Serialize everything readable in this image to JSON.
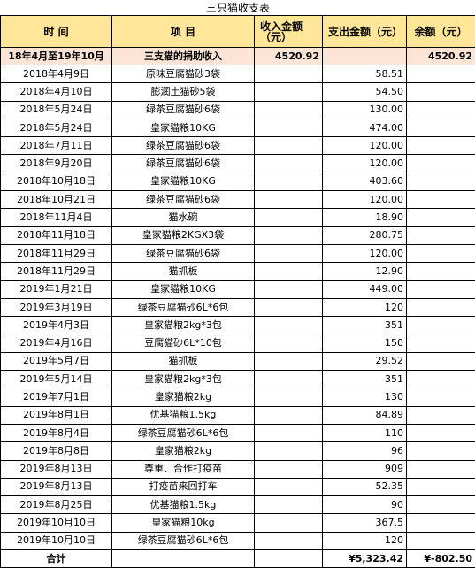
{
  "title": "三只猫收支表",
  "headers": {
    "date": "时    间",
    "item": "项    目",
    "income": "收入金额（元）",
    "expense": "支出金额（元）",
    "balance": "余额（元）"
  },
  "income_row": {
    "date": "18年4月至19年10月",
    "item": "三支猫的捐助收入",
    "income": "4520.92",
    "expense": "",
    "balance": "4520.92"
  },
  "rows": [
    {
      "date": "2018年4月9日",
      "item": "原味豆腐猫砂3袋",
      "expense": "58.51"
    },
    {
      "date": "2018年4月10日",
      "item": "膨润土猫砂5袋",
      "expense": "54.50"
    },
    {
      "date": "2018年5月24日",
      "item": "绿茶豆腐猫砂6袋",
      "expense": "130.00"
    },
    {
      "date": "2018年5月24日",
      "item": "皇家猫粮10KG",
      "expense": "474.00"
    },
    {
      "date": "2018年7月11日",
      "item": "绿茶豆腐猫砂6袋",
      "expense": "120.00"
    },
    {
      "date": "2018年9月20日",
      "item": "绿茶豆腐猫砂6袋",
      "expense": "120.00"
    },
    {
      "date": "2018年10月18日",
      "item": "皇家猫粮10KG",
      "expense": "403.60"
    },
    {
      "date": "2018年10月21日",
      "item": "绿茶豆腐猫砂6袋",
      "expense": "120.00"
    },
    {
      "date": "2018年11月4日",
      "item": "猫水碗",
      "expense": "18.90"
    },
    {
      "date": "2018年11月18日",
      "item": "皇家猫粮2KGX3袋",
      "expense": "280.75"
    },
    {
      "date": "2018年11月29日",
      "item": "绿茶豆腐猫砂6袋",
      "expense": "120.00"
    },
    {
      "date": "2018年11月29日",
      "item": "猫抓板",
      "expense": "12.90"
    },
    {
      "date": "2019年1月21日",
      "item": "皇家猫粮10KG",
      "expense": "449.00"
    },
    {
      "date": "2019年3月19日",
      "item": "绿茶豆腐猫砂6L*6包",
      "expense": "120"
    },
    {
      "date": "2019年4月3日",
      "item": "皇家猫粮2kg*3包",
      "expense": "351"
    },
    {
      "date": "2019年4月16日",
      "item": "豆腐猫砂6L*10包",
      "expense": "150"
    },
    {
      "date": "2019年5月7日",
      "item": "猫抓板",
      "expense": "29.52"
    },
    {
      "date": "2019年5月14日",
      "item": "皇家猫粮2kg*3包",
      "expense": "351"
    },
    {
      "date": "2019年7月1日",
      "item": "皇家猫粮2kg",
      "expense": "130"
    },
    {
      "date": "2019年8月1日",
      "item": "优基猫粮1.5kg",
      "expense": "84.89"
    },
    {
      "date": "2019年8月4日",
      "item": "绿茶豆腐猫砂6L*6包",
      "expense": "110"
    },
    {
      "date": "2019年8月8日",
      "item": "皇家猫粮2kg",
      "expense": "96"
    },
    {
      "date": "2019年8月13日",
      "item": "尊重、合作打疫苗",
      "expense": "909"
    },
    {
      "date": "2019年8月13日",
      "item": "打疫苗来回打车",
      "expense": "52.35"
    },
    {
      "date": "2019年8月25日",
      "item": "优基猫粮1.5kg",
      "expense": "90"
    },
    {
      "date": "2019年10月10日",
      "item": "皇家猫粮10kg",
      "expense": "367.5"
    },
    {
      "date": "2019年10月10日",
      "item": "绿茶豆腐猫砂6L*6包",
      "expense": "120"
    }
  ],
  "total": {
    "label": "合计",
    "expense": "¥5,323.42",
    "balance": "¥-802.50"
  }
}
